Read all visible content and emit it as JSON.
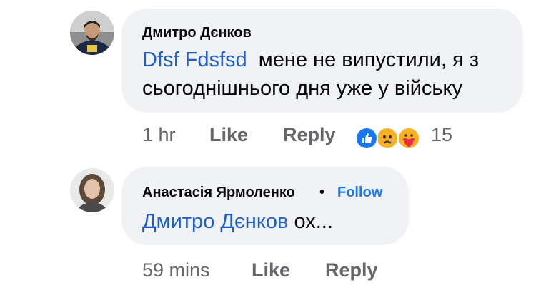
{
  "comments": [
    {
      "author": "Дмитро Дєнков",
      "mention": "Dfsf Fdsfsd",
      "text_line1": "мене не випустили, я з",
      "text_line2": "сьогоднішнього дня уже у війську",
      "time": "1 hr",
      "like_label": "Like",
      "reply_label": "Reply",
      "reaction_icons": [
        "like-icon",
        "sad-icon",
        "care-icon"
      ],
      "reaction_count": "15"
    },
    {
      "author": "Анастасія Ярмоленко",
      "separator": "•",
      "follow_label": "Follow",
      "mention": "Дмитро Дєнков",
      "text": "ох...",
      "time": "59 mins",
      "like_label": "Like",
      "reply_label": "Reply"
    }
  ],
  "colors": {
    "bubble": "#f0f2f5",
    "mention": "#1f5fc7",
    "follow": "#1877f2",
    "meta": "#65676b",
    "like_reaction": "#1877f2",
    "emoji_yellow": "#f7b125",
    "care_heart": "#f0284a"
  }
}
